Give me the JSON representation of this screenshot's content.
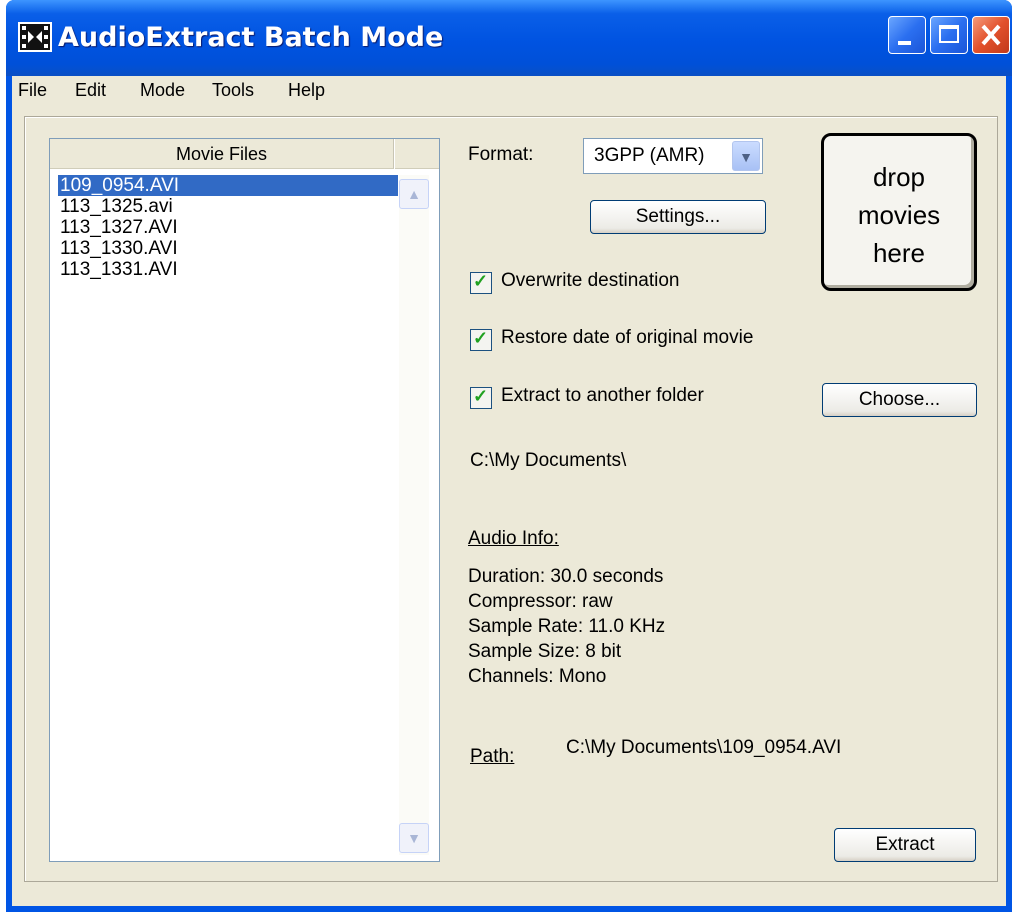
{
  "window": {
    "title": "AudioExtract Batch Mode"
  },
  "menu": [
    "File",
    "Edit",
    "Mode",
    "Tools",
    "Help"
  ],
  "file_list": {
    "header": "Movie Files",
    "items": [
      "109_0954.AVI",
      "113_1325.avi",
      "113_1327.AVI",
      "113_1330.AVI",
      "113_1331.AVI"
    ],
    "selected_index": 0
  },
  "format": {
    "label": "Format:",
    "value": "3GPP (AMR)"
  },
  "buttons": {
    "settings": "Settings...",
    "choose": "Choose...",
    "extract": "Extract"
  },
  "drop_zone": {
    "text": "drop movies here",
    "lines": [
      "drop",
      "movies",
      "here"
    ]
  },
  "options": [
    {
      "label": "Overwrite destination",
      "checked": true
    },
    {
      "label": "Restore date of original movie",
      "checked": true
    },
    {
      "label": "Extract to another folder",
      "checked": true
    }
  ],
  "folder_path": "C:\\My Documents\\",
  "audio_info": {
    "heading": "Audio Info:",
    "duration": "Duration: 30.0 seconds",
    "compressor": "Compressor: raw",
    "sample_rate": "Sample Rate: 11.0 KHz",
    "sample_size": "Sample Size: 8 bit",
    "channels": "Channels: Mono"
  },
  "path": {
    "label": "Path:",
    "value": "C:\\My Documents\\109_0954.AVI"
  },
  "colors": {
    "titlebar": "#0055e5",
    "selection": "#316ac5",
    "checkmark": "#21a121",
    "face": "#ece9d8"
  }
}
